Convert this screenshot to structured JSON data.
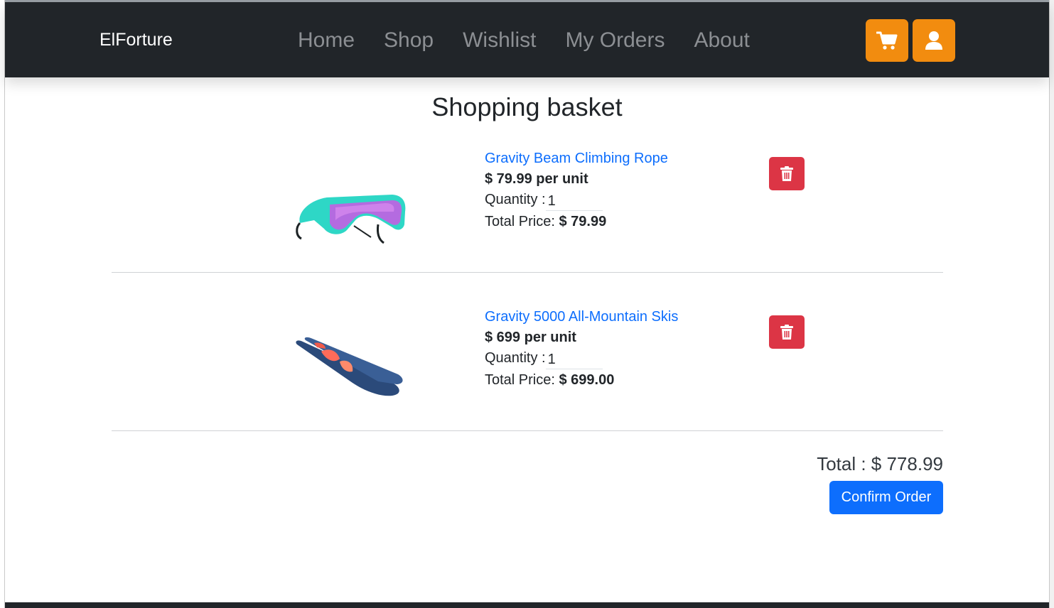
{
  "navbar": {
    "brand": "ElForture",
    "links": [
      "Home",
      "Shop",
      "Wishlist",
      "My Orders",
      "About"
    ],
    "cart_icon": "cart-icon",
    "user_icon": "user-icon",
    "accent_color": "#f28c0f"
  },
  "page": {
    "title": "Shopping basket"
  },
  "basket": {
    "items": [
      {
        "name": "Gravity Beam Climbing Rope",
        "price_per_unit": "$ 79.99 per unit",
        "quantity_label": "Quantity :",
        "quantity": "1",
        "total_label": "Total Price:",
        "total_price": "$ 79.99",
        "image": "sunglasses-image",
        "delete_icon": "trash-icon"
      },
      {
        "name": "Gravity 5000 All-Mountain Skis",
        "price_per_unit": "$ 699 per unit",
        "quantity_label": "Quantity :",
        "quantity": "1",
        "total_label": "Total Price:",
        "total_price": "$ 699.00",
        "image": "skis-image",
        "delete_icon": "trash-icon"
      }
    ],
    "grand_total": "Total : $ 778.99",
    "confirm_label": "Confirm Order"
  },
  "colors": {
    "navbar_bg": "#212529",
    "link_blue": "#0d6efd",
    "delete_red": "#dc3545"
  }
}
